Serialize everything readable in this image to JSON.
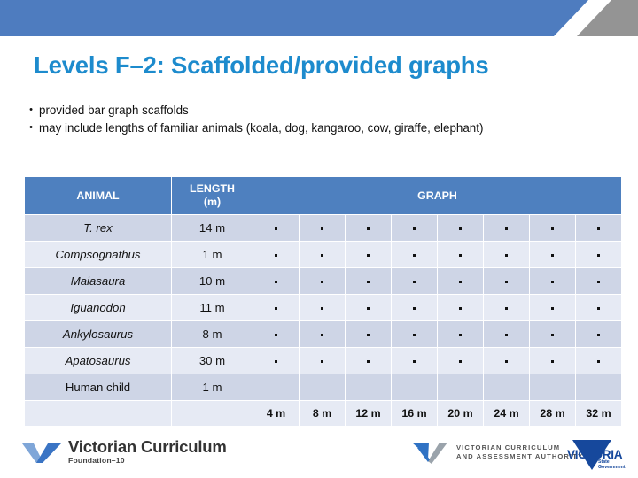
{
  "slide": {
    "title": "Levels F–2: Scaffolded/provided graphs",
    "bullets": [
      "provided bar graph scaffolds",
      "may include lengths of familiar animals (koala, dog, kangaroo, cow, giraffe, elephant)"
    ],
    "bullet_marker": "•"
  },
  "colors": {
    "banner_blue": "#4e7cbf",
    "banner_grey": "#949494",
    "title_blue": "#1d8bcd",
    "table_header_blue": "#4e80bf",
    "row_odd": "#ced5e6",
    "row_even": "#e6eaf4",
    "logo_blue": "#16489c"
  },
  "table": {
    "headers": [
      "ANIMAL",
      "LENGTH\n(m)",
      "GRAPH"
    ],
    "header_animal": "ANIMAL",
    "header_length_line1": "LENGTH",
    "header_length_line2": "(m)",
    "header_graph": "GRAPH",
    "graph_columns": 8,
    "rows": [
      {
        "animal": "T. rex",
        "length": "14 m",
        "italic": true,
        "dots": 8
      },
      {
        "animal": "Compsognathus",
        "length": "1 m",
        "italic": true,
        "dots": 8
      },
      {
        "animal": "Maiasaura",
        "length": "10 m",
        "italic": true,
        "dots": 8
      },
      {
        "animal": "Iguanodon",
        "length": "11 m",
        "italic": true,
        "dots": 8
      },
      {
        "animal": "Ankylosaurus",
        "length": "8 m",
        "italic": true,
        "dots": 8
      },
      {
        "animal": "Apatosaurus",
        "length": "30 m",
        "italic": true,
        "dots": 8
      },
      {
        "animal": "Human child",
        "length": "1 m",
        "italic": false,
        "dots": 0
      }
    ],
    "axis_labels": [
      "4 m",
      "8 m",
      "12 m",
      "16 m",
      "20 m",
      "24 m",
      "28 m",
      "32 m"
    ]
  },
  "footer": {
    "vc_title": "Victorian Curriculum",
    "vc_sub": "Foundation–10",
    "vcaa_line1": "VICTORIAN CURRICULUM",
    "vcaa_line2": "AND ASSESSMENT AUTHORITY",
    "vic_word": "VICTORIA",
    "vic_sub_line1": "State",
    "vic_sub_line2": "Government"
  }
}
